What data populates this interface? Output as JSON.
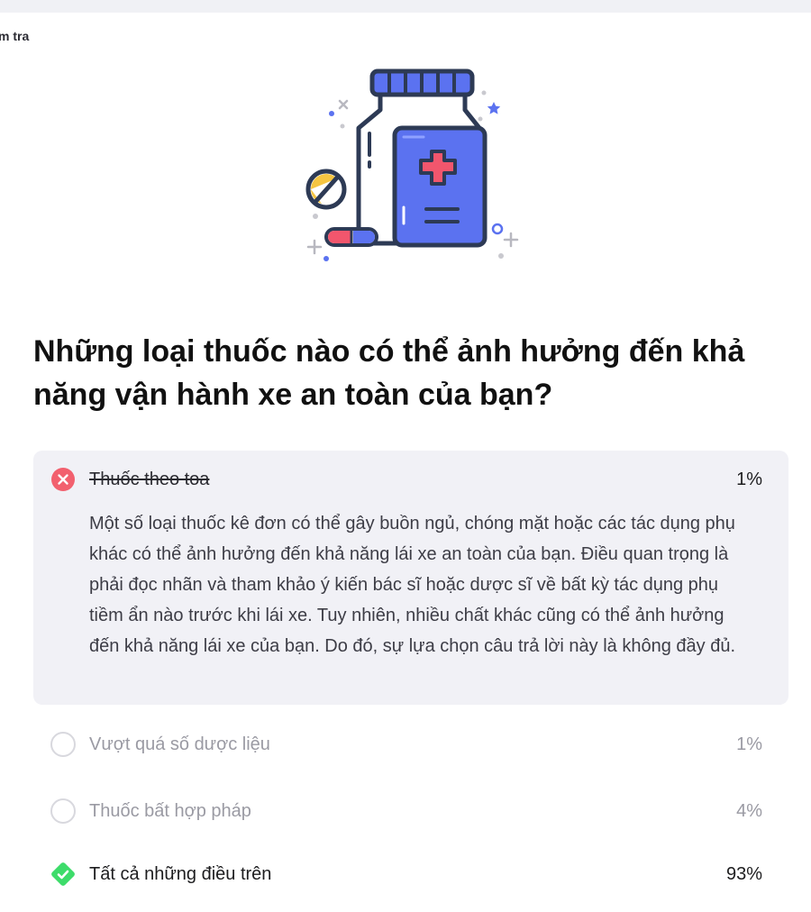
{
  "header": {
    "breadcrumb": "m tra"
  },
  "question": {
    "text": "Những loại thuốc nào có thể ảnh hưởng đến khả năng vận hành xe an toàn của bạn?"
  },
  "options": [
    {
      "label": "Thuốc theo toa",
      "percent": "1%",
      "state": "incorrect-selected",
      "explanation": "Một số loại thuốc kê đơn có thể gây buồn ngủ, chóng mặt hoặc các tác dụng phụ khác có thể ảnh hưởng đến khả năng lái xe an toàn của bạn. Điều quan trọng là phải đọc nhãn và tham khảo ý kiến bác sĩ hoặc dược sĩ về bất kỳ tác dụng phụ tiềm ẩn nào trước khi lái xe. Tuy nhiên, nhiều chất khác cũng có thể ảnh hưởng đến khả năng lái xe của bạn. Do đó, sự lựa chọn câu trả lời này là không đầy đủ."
    },
    {
      "label": "Vượt quá số dược liệu",
      "percent": "1%",
      "state": "unselected"
    },
    {
      "label": "Thuốc bất hợp pháp",
      "percent": "4%",
      "state": "unselected"
    },
    {
      "label": "Tất cả những điều trên",
      "percent": "93%",
      "state": "correct"
    }
  ],
  "colors": {
    "incorrect": "#f2606e",
    "correct": "#3ddc6a",
    "accent_blue": "#5b72f0",
    "outline": "#2d3a55",
    "cross": "#f2566d",
    "pill_yellow": "#f5c542"
  },
  "icons": {
    "illustration": "medicine-bottle-illustration",
    "incorrect": "x-circle-icon",
    "correct": "check-diamond-icon",
    "unselected": "radio-circle-icon"
  }
}
